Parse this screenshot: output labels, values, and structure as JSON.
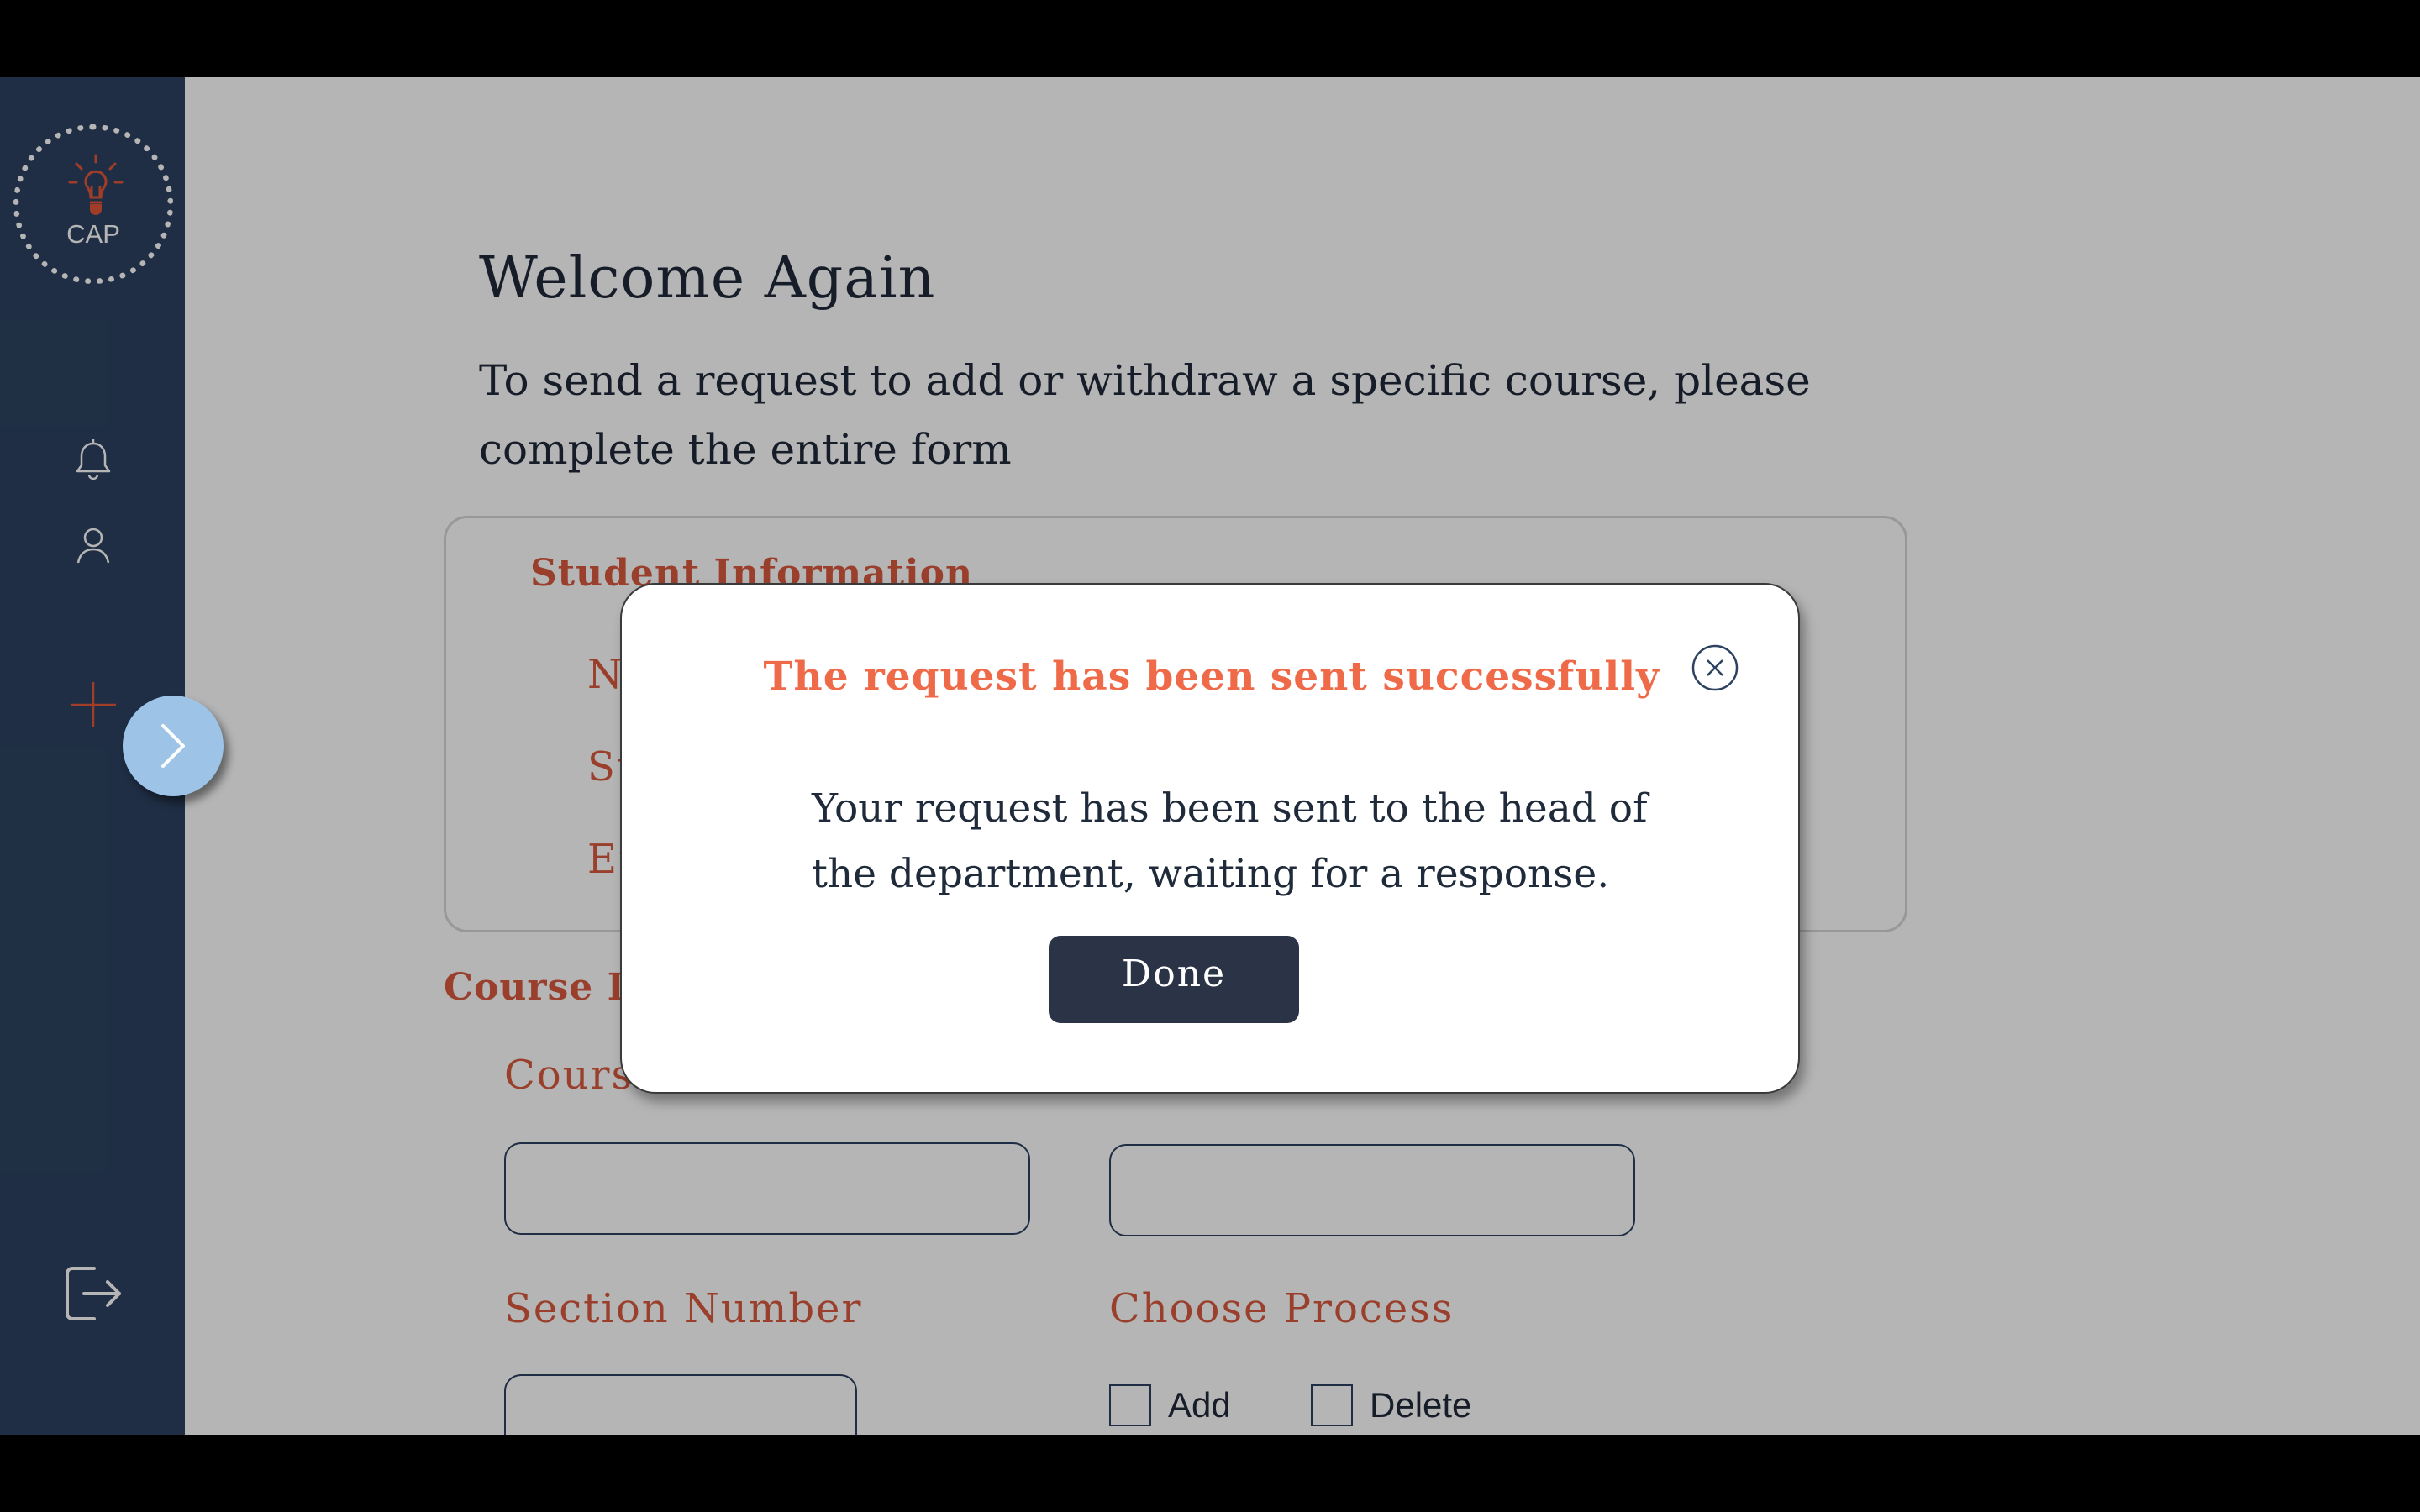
{
  "sidebar": {
    "logo_text": "CAP",
    "icons": [
      "bell-icon",
      "user-icon",
      "plus-icon",
      "logout-icon"
    ],
    "expand_icon": "chevron-right-icon"
  },
  "main": {
    "title": "Welcome Again",
    "subtitle": "To send a request to add or withdraw a specific course, please complete the entire form",
    "student_section": {
      "heading": "Student Information",
      "labels_partial": [
        "N",
        "St",
        "Er"
      ]
    },
    "course_section": {
      "heading_partial": "Course In",
      "course_label_partial": "Course",
      "section_number_label": "Section Number",
      "choose_process_label": "Choose Process",
      "options": [
        "Add",
        "Delete"
      ]
    }
  },
  "modal": {
    "title": "The request has been sent successfully",
    "body": "Your request has been sent to the head of the department, waiting for a response.",
    "done_label": "Done"
  },
  "colors": {
    "sidebar": "#2c4260",
    "accent": "#d85a3f",
    "modal_title": "#ef6a48",
    "button": "#2a3446"
  }
}
